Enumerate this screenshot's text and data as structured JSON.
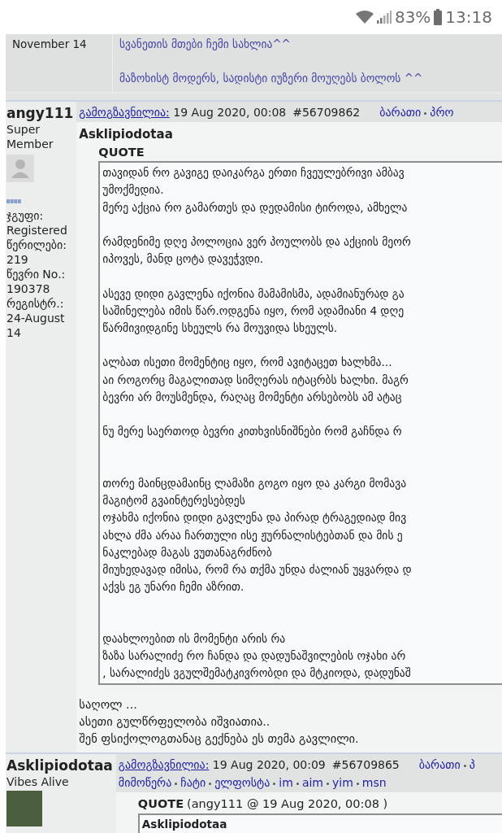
{
  "status_bar": {
    "battery": "83%",
    "time": "13:18"
  },
  "previous_post": {
    "date_text": "November 14",
    "signature": [
      {
        "kind": "line",
        "text": "სვანეთის მთები ჩემი სახლია^^"
      },
      {
        "kind": "blank"
      },
      {
        "kind": "line",
        "text": "მაზოხისტ მოდერს, სადისტი იუზერი მოუღებს ბოლოს ^^"
      }
    ]
  },
  "posts": [
    {
      "author": "angy111",
      "title": "Super Member",
      "avatar": {
        "kind": "silhouette"
      },
      "rank_pips": true,
      "info": [
        {
          "label": "ჯგუფი:",
          "value": "Registered"
        },
        {
          "label": "წერილები:",
          "value": "219"
        },
        {
          "label": "წევრი No.:",
          "value": "190378"
        },
        {
          "label": "რეგისტრ.:",
          "value": "24-August 14"
        }
      ],
      "sent_label": "გამოგზავნილია:",
      "date": "19 Aug 2020, 00:08",
      "post_number": "#56709862",
      "link_rows": [
        [
          "ბარათი",
          "პრო"
        ]
      ],
      "quoted_author": "Asklipiodotaa",
      "quote": {
        "label": "QUOTE",
        "lines": [
          {
            "kind": "line",
            "text": "თავიდან რო გავიგე დაიკარგა ერთი ჩვეულებრივი ამბავ"
          },
          {
            "kind": "line",
            "text": "უმოქმედია."
          },
          {
            "kind": "line",
            "text": "მერე აქცია რო გამართეს და დედამისი ტიროდა, ამხელა"
          },
          {
            "kind": "blank"
          },
          {
            "kind": "line",
            "text": "რამდენიმე დღე პოლოცია ვერ პოულობს და აქციის მეორ"
          },
          {
            "kind": "line",
            "text": "იპოვეს, მანდ ცოტა დავეჭვდი."
          },
          {
            "kind": "blank"
          },
          {
            "kind": "line",
            "text": "ასევე დიდი გავლენა იქონია მამამისმა, ადამიანურად გა"
          },
          {
            "kind": "line",
            "text": "საშინელება იმის წარ.ოდგენა იყო, რომ ადამიანი 4 დღე"
          },
          {
            "kind": "line",
            "text": "წარმივიდგინე სხეულს რა მოუვიდა სხეულს."
          },
          {
            "kind": "blank"
          },
          {
            "kind": "line",
            "text": "ალბათ ისეთი მომენტიც იყო, რომ ავიტაცეთ ხალხმა..."
          },
          {
            "kind": "line",
            "text": "აი როგორც მაგალითად სიმღერას იტაცრბს ხალხი. მაგრ"
          },
          {
            "kind": "line",
            "text": "ბევრი არ მოუსმენდა, რაღაც მომენტი არსებობს ამ ატაც"
          },
          {
            "kind": "blank"
          },
          {
            "kind": "line",
            "text": "ნუ მერე საერთოდ ბევრი კითხვისნიშნები რომ გაჩნდა რ"
          },
          {
            "kind": "blank"
          },
          {
            "kind": "blank"
          },
          {
            "kind": "line",
            "text": "თორე მაინცდამაინც ლამაზი გოგო იყო და კარგი მომავა"
          },
          {
            "kind": "line",
            "text": "მაგიტომ გვაინტერესებდეს"
          },
          {
            "kind": "line",
            "text": "ოჯახმა იქონია დიდი გავლენა და პირად ტრაგედიად მივ"
          },
          {
            "kind": "line",
            "text": "ახლა ძმა არაა ჩართული ისე ჟურნალისტებთან და მის ე"
          },
          {
            "kind": "line",
            "text": "ნაკლებად მაგას ვუთანაგრძნობ"
          },
          {
            "kind": "line",
            "text": "მიუხედავად იმისა, რომ რა თქმა უნდა ძალიან უყვარდა დ"
          },
          {
            "kind": "line",
            "text": "აქვს ეგ უნარი ჩემი აზრით."
          },
          {
            "kind": "blank"
          },
          {
            "kind": "blank"
          },
          {
            "kind": "line",
            "text": "დაახლოებით ის მომენტი არის რა"
          },
          {
            "kind": "line",
            "text": "ზაზა სარალიძე რო ჩანდა და დადუნაშვილების ოჯახი არ"
          },
          {
            "kind": "line",
            "text": ", სარალიძეს ვგულშემატკივრობდი და მტკიოდა, დადუნაშ"
          }
        ]
      },
      "reply_lines": [
        "საღოლ ...",
        "ასეთი გულწრფელობა იშვიათია..",
        "შენ ფსიქოლოგთანაც გექნება ეს თემა გავლილი."
      ]
    },
    {
      "author": "Asklipiodotaa",
      "title": "Vibes Alive",
      "avatar": {
        "kind": "photo"
      },
      "rank_pips": false,
      "sent_label": "გამოგზავნილია:",
      "date": "19 Aug 2020, 00:09",
      "post_number": "#56709865",
      "link_rows": [
        [
          "ბარათი",
          "პ"
        ],
        [
          "მიმოწერა",
          "ჩატი",
          "ელფოსტა",
          "im",
          "aim",
          "yim",
          "msn"
        ]
      ],
      "quote": {
        "label": "QUOTE",
        "source": "(angy111 @ 19 Aug 2020, 00:08 )",
        "title": "Asklipiodotaa"
      }
    }
  ]
}
